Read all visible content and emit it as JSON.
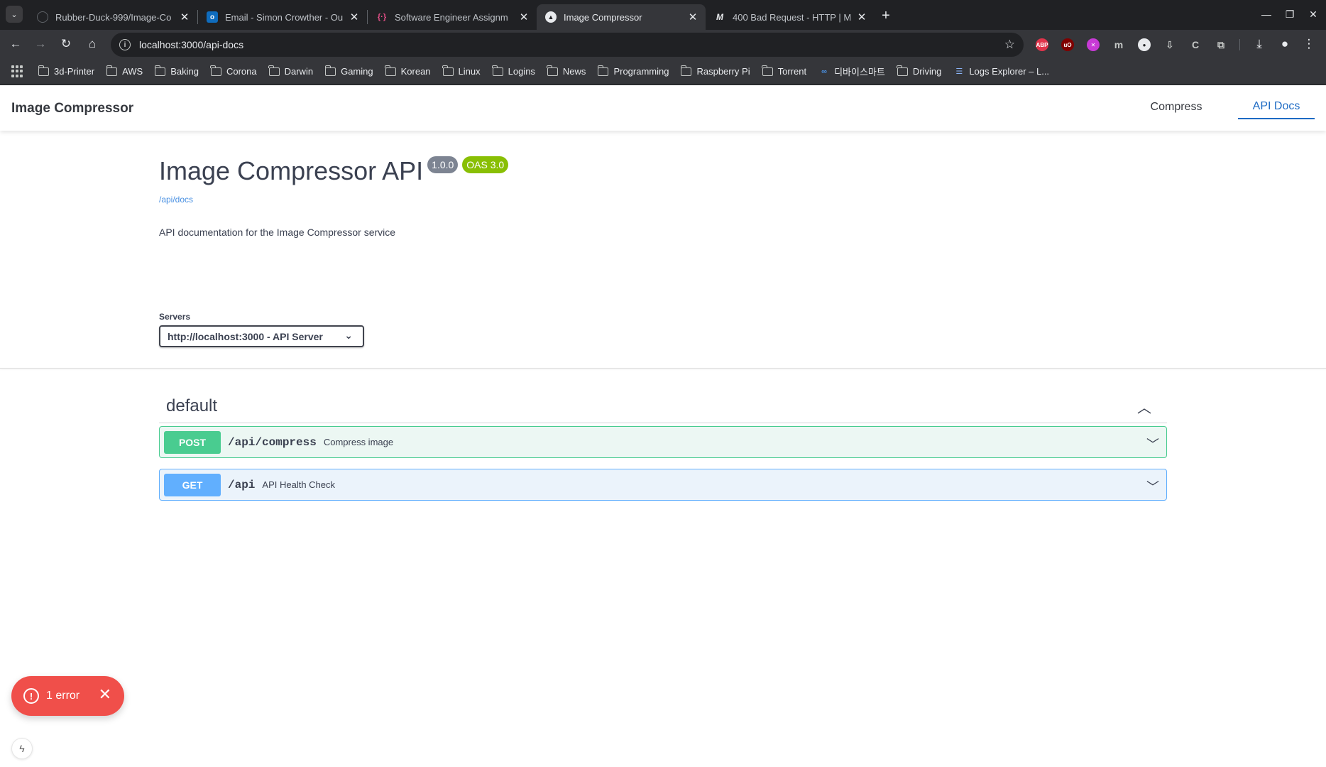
{
  "browser": {
    "tabs": [
      {
        "title": "Rubber-Duck-999/Image-Co",
        "favicon": "github-icon",
        "active": false
      },
      {
        "title": "Email - Simon Crowther - Ou",
        "favicon": "outlook-icon",
        "active": false
      },
      {
        "title": "Software Engineer Assignm",
        "favicon": "brackets-icon",
        "active": false
      },
      {
        "title": "Image Compressor",
        "favicon": "nextjs-icon",
        "active": true
      },
      {
        "title": "400 Bad Request - HTTP | M",
        "favicon": "mdn-icon",
        "active": false
      }
    ],
    "url": "localhost:3000/api-docs",
    "extensions": [
      {
        "name": "adblock-plus-icon",
        "label": "ABP",
        "color": "#e0344b"
      },
      {
        "name": "ublock-icon",
        "label": "uO",
        "color": "#800000"
      },
      {
        "name": "extension-purple-icon",
        "label": "✕",
        "color": "#c83ad6"
      },
      {
        "name": "extension-m-icon",
        "label": "m",
        "color": "#6b6f75"
      },
      {
        "name": "extension-circle-icon",
        "label": "●",
        "color": "#e8eaed"
      },
      {
        "name": "download-helper-icon",
        "label": "⇩",
        "color": "#6b6f75"
      },
      {
        "name": "extension-c-icon",
        "label": "C",
        "color": "#6b6f75"
      },
      {
        "name": "extensions-puzzle-icon",
        "label": "⧉",
        "color": "#6b6f75"
      }
    ],
    "bookmarks": [
      {
        "label": "3d-Printer",
        "icon": "folder-icon"
      },
      {
        "label": "AWS",
        "icon": "folder-icon"
      },
      {
        "label": "Baking",
        "icon": "folder-icon"
      },
      {
        "label": "Corona",
        "icon": "folder-icon"
      },
      {
        "label": "Darwin",
        "icon": "folder-icon"
      },
      {
        "label": "Gaming",
        "icon": "folder-icon"
      },
      {
        "label": "Korean",
        "icon": "folder-icon"
      },
      {
        "label": "Linux",
        "icon": "folder-icon"
      },
      {
        "label": "Logins",
        "icon": "folder-icon"
      },
      {
        "label": "News",
        "icon": "folder-icon"
      },
      {
        "label": "Programming",
        "icon": "folder-icon"
      },
      {
        "label": "Raspberry Pi",
        "icon": "folder-icon"
      },
      {
        "label": "Torrent",
        "icon": "folder-icon"
      },
      {
        "label": "디바이스마트",
        "icon": "devicemart-icon"
      },
      {
        "label": "Driving",
        "icon": "folder-icon"
      },
      {
        "label": "Logs Explorer – L...",
        "icon": "logs-explorer-icon"
      }
    ]
  },
  "app": {
    "brand": "Image Compressor",
    "nav": [
      {
        "label": "Compress",
        "active": false
      },
      {
        "label": "API Docs",
        "active": true
      }
    ]
  },
  "swagger": {
    "title": "Image Compressor API",
    "version": "1.0.0",
    "oas": "OAS 3.0",
    "base_link": "/api/docs",
    "description": "API documentation for the Image Compressor service",
    "servers_label": "Servers",
    "server_selected": "http://localhost:3000 - API Server",
    "tag": "default",
    "operations": [
      {
        "method": "POST",
        "path": "/api/compress",
        "summary": "Compress image",
        "color": "#49cc90"
      },
      {
        "method": "GET",
        "path": "/api",
        "summary": "API Health Check",
        "color": "#61affe"
      }
    ]
  },
  "dev_overlay": {
    "error_text": "1 error"
  }
}
